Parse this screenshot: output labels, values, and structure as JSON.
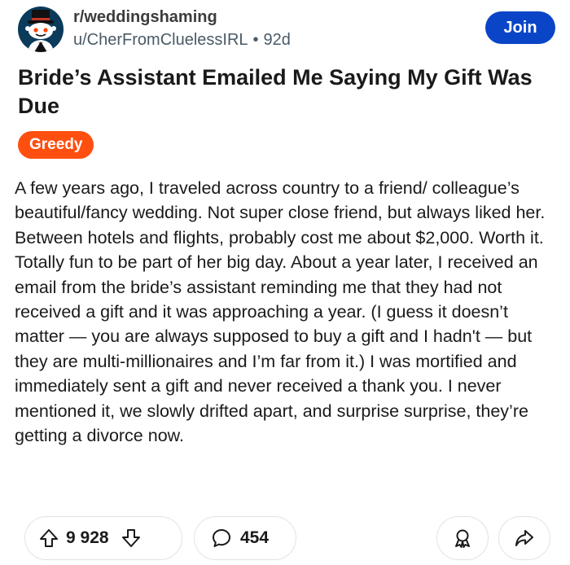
{
  "post": {
    "subreddit": "r/weddingshaming",
    "author": "u/CherFromCluelessIRL",
    "separator": "•",
    "age": "92d",
    "join_label": "Join",
    "title": "Bride’s Assistant Emailed Me Saying My Gift Was Due",
    "flair": "Greedy",
    "body": "A few years ago, I traveled across country to a friend/ colleague’s beautiful/fancy wedding. Not super close friend, but always liked her. Between hotels and flights, probably cost me about $2,000. Worth it. Totally fun to be part of her big day. About a year later, I received an email from the bride’s assistant reminding me that they had not received a gift and it was approaching a year. (I guess it doesn’t matter — you are always supposed to buy a gift and I hadn't — but they are multi-millionaires and I’m far from it.) I was mortified and immediately sent a gift and never received a thank you. I never mentioned it, we slowly drifted apart, and surprise surprise, they’re getting a divorce now."
  },
  "actions": {
    "votes": "9 928",
    "comments": "454"
  },
  "colors": {
    "join": "#0a45c7",
    "flair": "#ff4f10",
    "avatar_bg": "#0b3a5b"
  },
  "icons": {
    "avatar": "snoo-top-hat-avatar-icon",
    "upvote": "arrow-up-icon",
    "downvote": "arrow-down-icon",
    "comment": "speech-bubble-icon",
    "award": "award-ribbon-icon",
    "share": "share-arrow-icon"
  }
}
